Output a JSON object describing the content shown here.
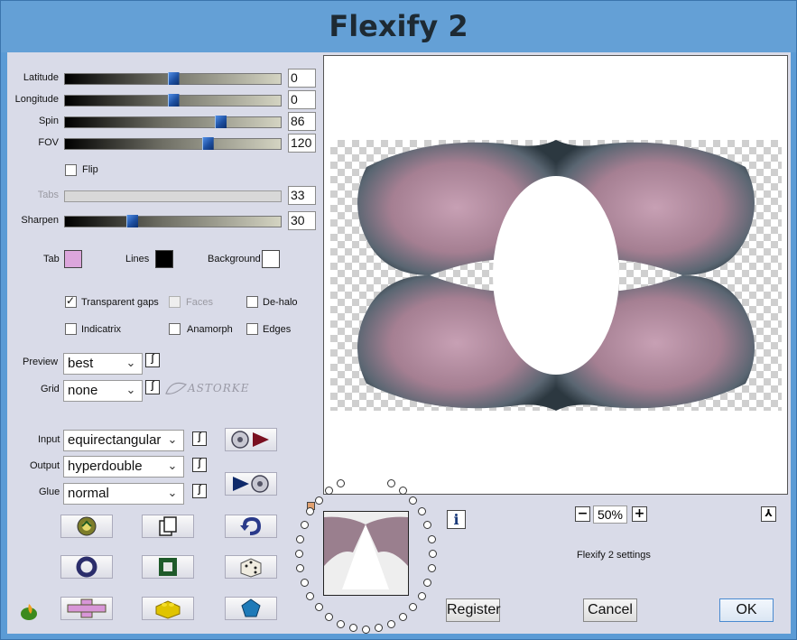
{
  "window": {
    "title": "Flexify 2"
  },
  "sliders": [
    {
      "label": "Latitude",
      "value": "0",
      "fraction": 0.5,
      "enabled": true
    },
    {
      "label": "Longitude",
      "value": "0",
      "fraction": 0.5,
      "enabled": true
    },
    {
      "label": "Spin",
      "value": "86",
      "fraction": 0.72,
      "enabled": true
    },
    {
      "label": "FOV",
      "value": "120",
      "fraction": 0.66,
      "enabled": true
    },
    {
      "label": "Tabs",
      "value": "33",
      "fraction": 0,
      "enabled": false
    },
    {
      "label": "Sharpen",
      "value": "30",
      "fraction": 0.31,
      "enabled": true
    }
  ],
  "flip": {
    "label": "Flip",
    "checked": false
  },
  "colors": {
    "tab": {
      "label": "Tab",
      "color": "#dca6dc"
    },
    "lines": {
      "label": "Lines",
      "color": "#000000"
    },
    "background": {
      "label": "Background",
      "color": "#ffffff"
    }
  },
  "options": {
    "transparent_gaps": {
      "label": "Transparent gaps",
      "checked": true
    },
    "faces": {
      "label": "Faces",
      "checked": false,
      "enabled": false
    },
    "de_halo": {
      "label": "De-halo",
      "checked": false
    },
    "indicatrix": {
      "label": "Indicatrix",
      "checked": false
    },
    "anamorph": {
      "label": "Anamorph",
      "checked": false
    },
    "edges": {
      "label": "Edges",
      "checked": false
    }
  },
  "preview_select": {
    "label": "Preview",
    "value": "best"
  },
  "grid_select": {
    "label": "Grid",
    "value": "none"
  },
  "input_select": {
    "label": "Input",
    "value": "equirectangular"
  },
  "output_select": {
    "label": "Output",
    "value": "hyperdouble"
  },
  "glue_select": {
    "label": "Glue",
    "value": "normal"
  },
  "watermark": {
    "text": "ASTORKE"
  },
  "zoom": {
    "value": "50%",
    "minus": "−",
    "plus": "+"
  },
  "settings_text": "Flexify 2 settings",
  "buttons": {
    "register": "Register",
    "cancel": "Cancel",
    "ok": "OK"
  },
  "icons": {
    "info": "i",
    "link": "∫",
    "corner": "⅄"
  },
  "accent": "#64a0d6"
}
